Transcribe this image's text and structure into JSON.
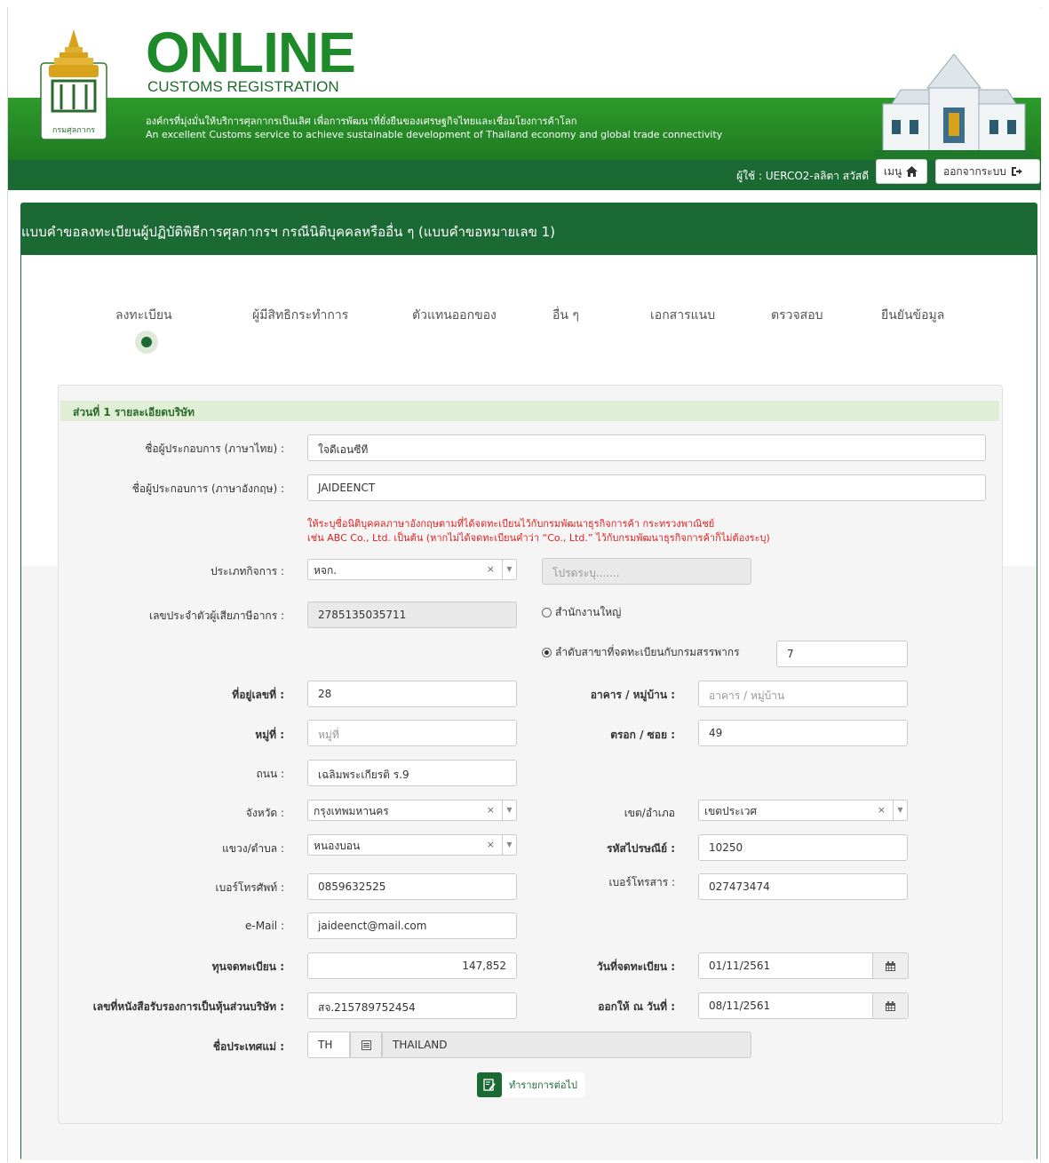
{
  "header": {
    "brand_title": "ONLINE",
    "brand_subtitle": "CUSTOMS REGISTRATION",
    "seal_text": "กรมศุลกากร",
    "tagline_th": "องค์กรที่มุ่งมั่นให้บริการศุลกากรเป็นเลิศ เพื่อการพัฒนาที่ยั่งยืนของเศรษฐกิจไทยและเชื่อมโยงการค้าโลก",
    "tagline_en": "An excellent Customs service to achieve sustainable development of Thailand economy and global trade connectivity",
    "user_label": "ผู้ใช้ : UERCO2-ลลิตา สวัสดี",
    "menu_label": "เมนู",
    "logout_label": "ออกจากระบบ"
  },
  "panel": {
    "title": "แบบคำขอลงทะเบียนผู้ปฏิบัติพิธีการศุลกากรฯ กรณีนิติบุคคลหรืออื่น ๆ (แบบคำขอหมายเลข 1)"
  },
  "steps": [
    "ลงทะเบียน",
    "ผู้มีสิทธิกระทำการ",
    "ตัวแทนออกของ",
    "อื่น ๆ",
    "เอกสารแนบ",
    "ตรวจสอบ",
    "ยืนยันข้อมูล"
  ],
  "form": {
    "section_title": "ส่วนที่ 1 รายละเอียดบริษัท",
    "labels": {
      "name_th": "ชื่อผู้ประกอบการ (ภาษาไทย) :",
      "name_en": "ชื่อผู้ประกอบการ (ภาษาอังกฤษ) :",
      "business_type": "ประเภทกิจการ :",
      "tax_id": "เลขประจำตัวผู้เสียภาษีอากร :",
      "address_no": "ที่อยู่เลขที่ :",
      "building": "อาคาร / หมู่บ้าน :",
      "moo": "หมู่ที่ :",
      "soi": "ตรอก / ซอย :",
      "road": "ถนน :",
      "province": "จังหวัด :",
      "district": "เขต/อำเภอ",
      "subdistrict": "แขวง/ตำบล :",
      "postcode": "รหัสไปรษณีย์ :",
      "phone": "เบอร์โทรศัพท์ :",
      "fax": "เบอร์โทรสาร :",
      "email": "e-Mail :",
      "capital": "ทุนจดทะเบียน :",
      "reg_date": "วันที่จดทะเบียน :",
      "cert_no": "เลขที่หนังสือรับรองการเป็นหุ้นส่วนบริษัท :",
      "issue_date": "ออกให้ ณ วันที่ :",
      "country": "ชื่อประเทศแม่ :"
    },
    "values": {
      "name_th": "ใจดีเอนซีที",
      "name_en": "JAIDEENCT",
      "business_type": "หจก.",
      "business_type_other_placeholder": "โปรดระบุ.......",
      "tax_id": "2785135035711",
      "branch_no": "7",
      "address_no": "28",
      "building_placeholder": "อาคาร / หมู่บ้าน",
      "moo_placeholder": "หมู่ที่",
      "soi": "49",
      "road": "เฉลิมพระเกียรติ ร.9",
      "province": "กรุงเทพมหานคร",
      "district": "เขตประเวศ",
      "subdistrict": "หนองบอน",
      "postcode": "10250",
      "phone": "0859632525",
      "fax": "027473474",
      "email": "jaideenct@mail.com",
      "capital": "147,852",
      "reg_date": "01/11/2561",
      "cert_no": "สจ.215789752454",
      "issue_date": "08/11/2561",
      "country_code": "TH",
      "country_name": "THAILAND"
    },
    "warning_line1": "ให้ระบุชื่อนิติบุคคลภาษาอังกฤษตามที่ได้จดทะเบียนไว้กับกรมพัฒนาธุรกิจการค้า กระทรวงพาณิชย์",
    "warning_line2": "เช่น ABC Co., Ltd. เป็นต้น (หากไม่ได้จดทะเบียนคำว่า “Co., Ltd.” ไว้กับกรมพัฒนาธุรกิจการค้าก็ไม่ต้องระบุ)",
    "radio_head_office": "สำนักงานใหญ่",
    "radio_branch": "ลำดับสาขาที่จดทะเบียนกับกรมสรรพากร",
    "select_clear": "×",
    "next_label": "ทำรายการต่อไป"
  },
  "colors": {
    "brand_green": "#1b6a34",
    "header_green": "#2e9a2c",
    "warning_red": "#e02020",
    "section_bg": "#dfeed5"
  },
  "icons": [
    "home-icon",
    "sign-out-icon",
    "calendar-icon",
    "list-icon",
    "edit-icon"
  ]
}
